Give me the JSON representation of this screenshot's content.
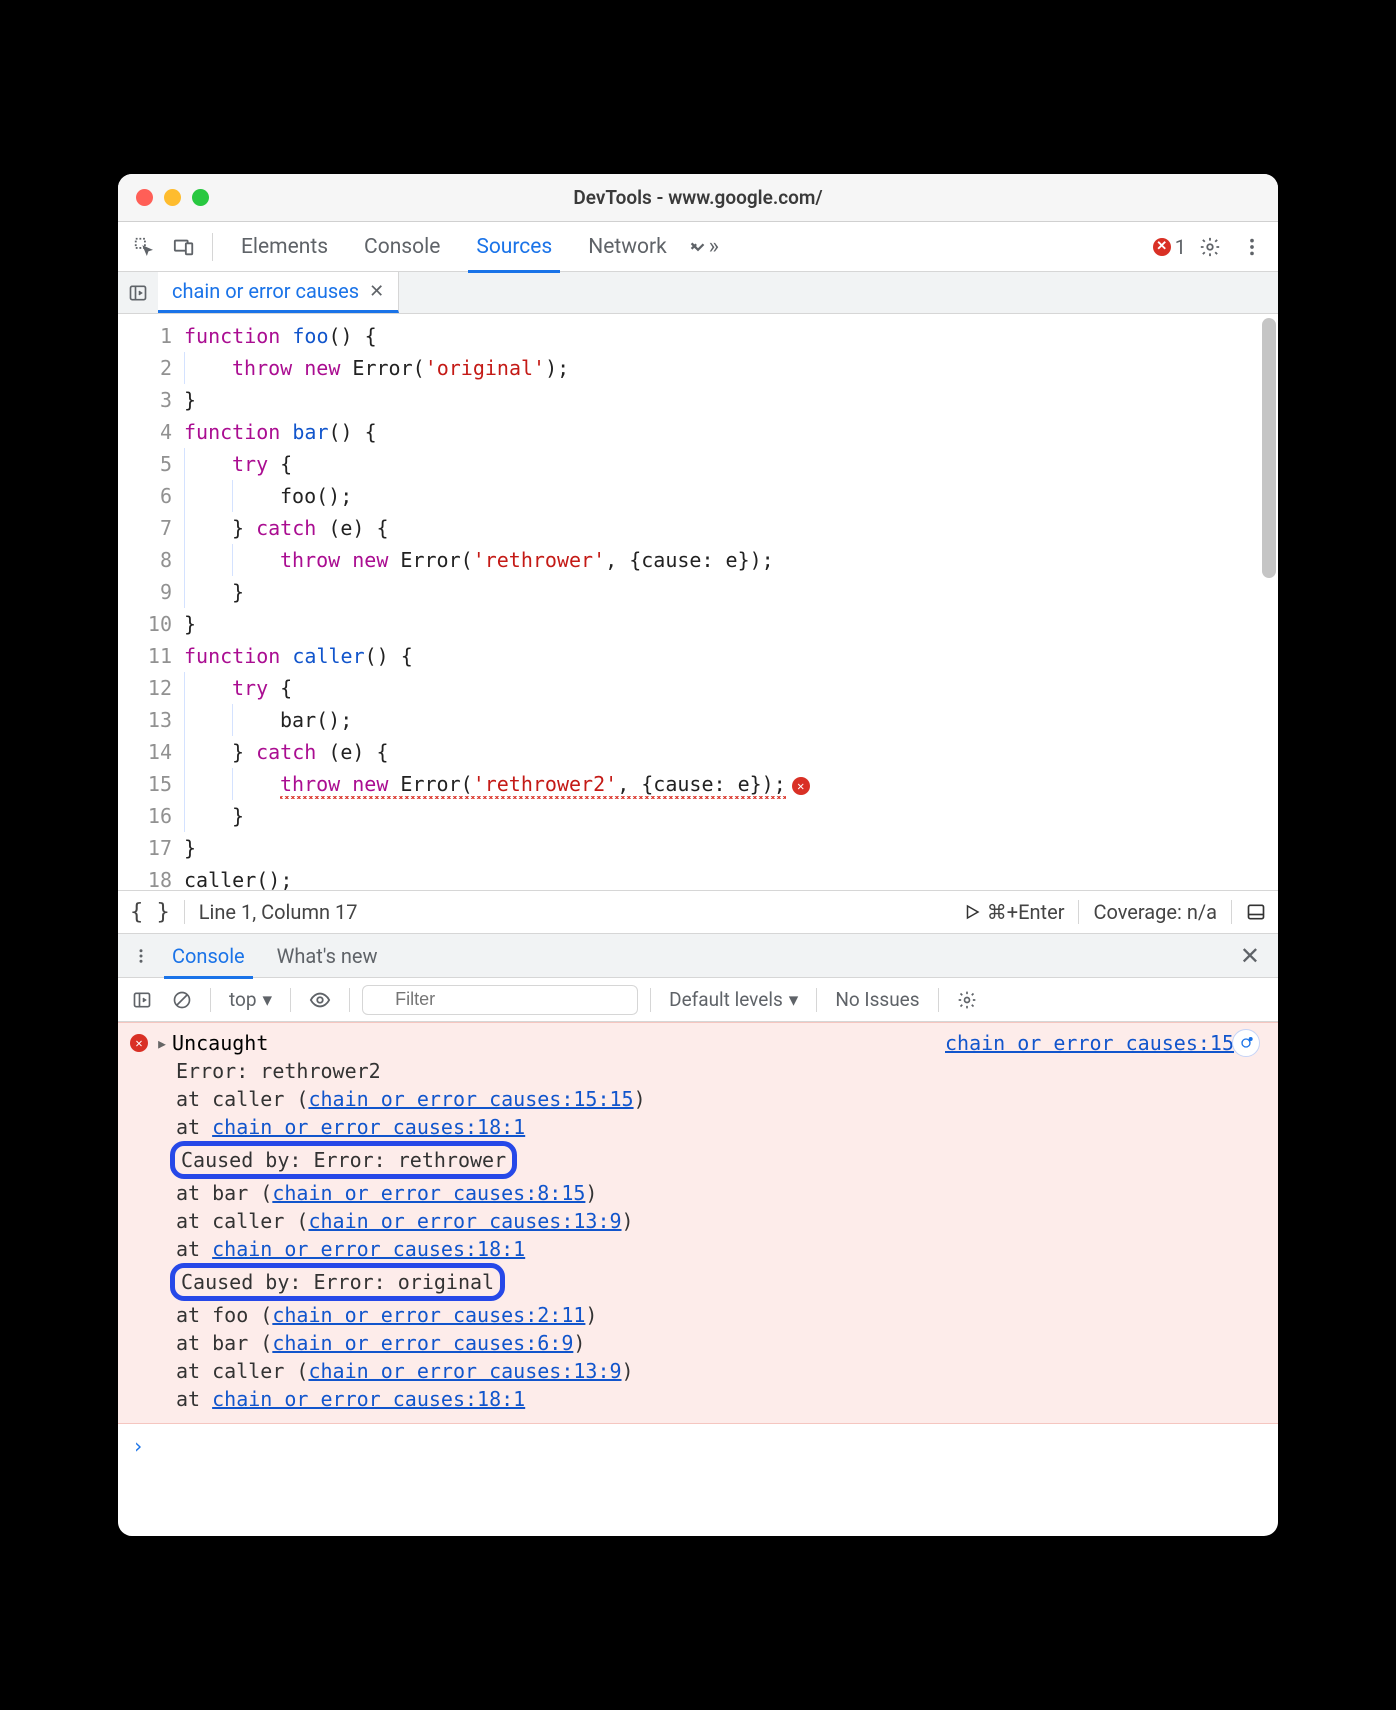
{
  "window": {
    "title": "DevTools - www.google.com/"
  },
  "main_tabs": {
    "elements": "Elements",
    "console": "Console",
    "sources": "Sources",
    "network": "Network",
    "active": "sources"
  },
  "error_badge": {
    "count": "1"
  },
  "file_tab": {
    "name": "chain or error causes",
    "close_tooltip": "Close"
  },
  "code_lines": [
    {
      "n": "1",
      "indent": 0,
      "html": "<span class='kw'>function</span> <span class='fn'>foo</span>() {"
    },
    {
      "n": "2",
      "indent": 1,
      "html": "<span class='kw'>throw</span> <span class='kw'>new</span> Error(<span class='str'>'original'</span>);"
    },
    {
      "n": "3",
      "indent": 0,
      "html": "}"
    },
    {
      "n": "4",
      "indent": 0,
      "html": "<span class='kw'>function</span> <span class='fn'>bar</span>() {"
    },
    {
      "n": "5",
      "indent": 1,
      "html": "<span class='kw'>try</span> {"
    },
    {
      "n": "6",
      "indent": 2,
      "html": "foo();"
    },
    {
      "n": "7",
      "indent": 1,
      "html": "} <span class='kw'>catch</span> (e) {"
    },
    {
      "n": "8",
      "indent": 2,
      "html": "<span class='kw'>throw</span> <span class='kw'>new</span> Error(<span class='str'>'rethrower'</span>, {cause: e});"
    },
    {
      "n": "9",
      "indent": 1,
      "html": "}"
    },
    {
      "n": "10",
      "indent": 0,
      "html": "}"
    },
    {
      "n": "11",
      "indent": 0,
      "html": "<span class='kw'>function</span> <span class='fn'>caller</span>() {"
    },
    {
      "n": "12",
      "indent": 1,
      "html": "<span class='kw'>try</span> {"
    },
    {
      "n": "13",
      "indent": 2,
      "html": "bar();"
    },
    {
      "n": "14",
      "indent": 1,
      "html": "} <span class='kw'>catch</span> (e) {"
    },
    {
      "n": "15",
      "indent": 2,
      "html": "<span class='squiggle'><span class='kw'>throw</span> <span class='kw'>new</span> Error(<span class='str'>'rethrower2'</span>, {cause: e});</span><span class='line-err-icon'>✕</span>",
      "error": true
    },
    {
      "n": "16",
      "indent": 1,
      "html": "}"
    },
    {
      "n": "17",
      "indent": 0,
      "html": "}"
    },
    {
      "n": "18",
      "indent": 0,
      "html": "caller();"
    }
  ],
  "status": {
    "cursor": "Line 1, Column 17",
    "run_hint": "⌘+Enter",
    "coverage": "Coverage: n/a"
  },
  "drawer_tabs": {
    "console": "Console",
    "whatsnew": "What's new",
    "active": "console"
  },
  "console_toolbar": {
    "context": "top",
    "filter_placeholder": "Filter",
    "levels": "Default levels",
    "issues": "No Issues"
  },
  "console_message": {
    "source_link": "chain or error causes:15",
    "lines": [
      {
        "text": "Uncaught",
        "head": true
      },
      {
        "text": "Error: rethrower2"
      },
      {
        "text": "    at caller (",
        "link": "chain or error causes:15:15",
        "suffix": ")"
      },
      {
        "text": "    at ",
        "link": "chain or error causes:18:1"
      },
      {
        "text": "Caused by: Error: rethrower",
        "highlighted": true
      },
      {
        "text": "    at bar (",
        "link": "chain or error causes:8:15",
        "suffix": ")"
      },
      {
        "text": "    at caller (",
        "link": "chain or error causes:13:9",
        "suffix": ")"
      },
      {
        "text": "    at ",
        "link": "chain or error causes:18:1"
      },
      {
        "text": "Caused by: Error: original",
        "highlighted": true
      },
      {
        "text": "    at foo (",
        "link": "chain or error causes:2:11",
        "suffix": ")"
      },
      {
        "text": "    at bar (",
        "link": "chain or error causes:6:9",
        "suffix": ")"
      },
      {
        "text": "    at caller (",
        "link": "chain or error causes:13:9",
        "suffix": ")"
      },
      {
        "text": "    at ",
        "link": "chain or error causes:18:1"
      }
    ]
  }
}
